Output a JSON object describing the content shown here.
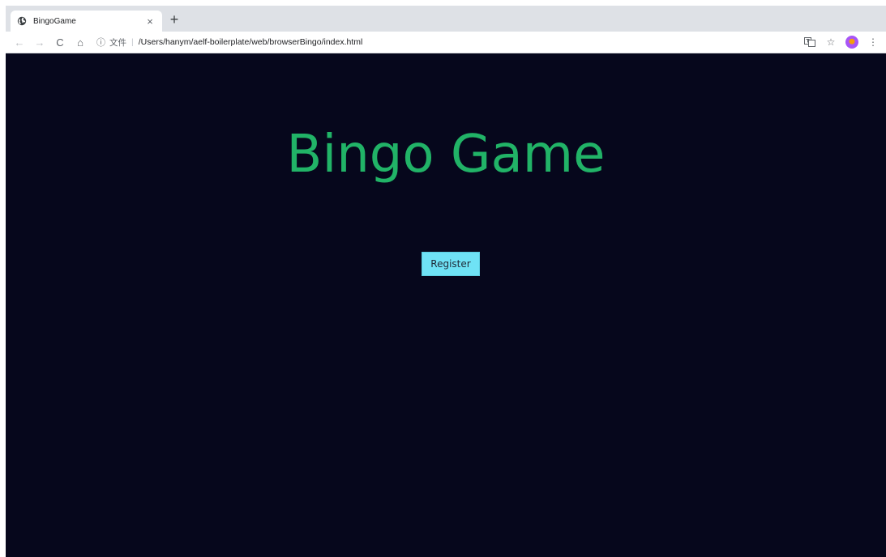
{
  "browser": {
    "tab": {
      "title": "BingoGame",
      "close_glyph": "×",
      "favicon": "globe-icon"
    },
    "new_tab_glyph": "+",
    "nav": {
      "back": "←",
      "forward": "→",
      "reload": "C",
      "home": "⌂"
    },
    "address": {
      "info_glyph": "ⓘ",
      "scheme_label": "文件",
      "separator": "|",
      "path": "/Users/hanym/aelf-boilerplate/web/browserBingo/index.html"
    },
    "actions": {
      "translate": "translate-icon",
      "bookmark": "☆",
      "menu": "⋮"
    }
  },
  "page": {
    "heading": "Bingo Game",
    "register_label": "Register",
    "colors": {
      "background": "#06071c",
      "heading": "#21b367",
      "button": "#6fe2f5"
    }
  }
}
